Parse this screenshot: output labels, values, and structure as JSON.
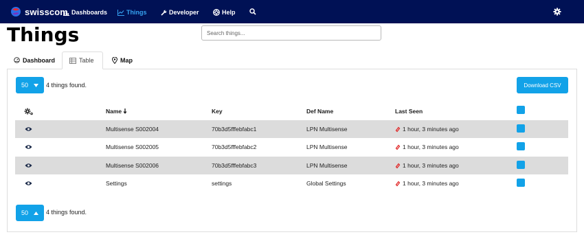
{
  "nav": {
    "brand": "swisscom",
    "items": [
      {
        "label": "Dashboards",
        "icon": "bar-chart-icon"
      },
      {
        "label": "Things",
        "icon": "line-chart-icon",
        "active": true
      },
      {
        "label": "Developer",
        "icon": "wrench-icon"
      },
      {
        "label": "Help",
        "icon": "lifebuoy-icon"
      }
    ],
    "search_icon": "search-icon",
    "settings_icon": "gear-icon"
  },
  "page": {
    "title": "Things",
    "search_placeholder": "Search things..."
  },
  "tabs": [
    {
      "label": "Dashboard",
      "icon": "dashboard-icon"
    },
    {
      "label": "Table",
      "icon": "table-icon",
      "active": true
    },
    {
      "label": "Map",
      "icon": "map-marker-icon"
    }
  ],
  "toolbar": {
    "per_page_top": "50",
    "per_page_bottom": "50",
    "found_top": "4 things found.",
    "found_bottom": "4 things found.",
    "download_label": "Download CSV"
  },
  "table": {
    "columns": [
      "Name",
      "Key",
      "Def Name",
      "Last Seen"
    ],
    "rows": [
      {
        "name": "Multisense S002004",
        "key": "70b3d5fffebfabc1",
        "def_name": "LPN Multisense",
        "last_seen": "1 hour, 3 minutes ago"
      },
      {
        "name": "Multisense S002005",
        "key": "70b3d5fffebfabc2",
        "def_name": "LPN Multisense",
        "last_seen": "1 hour, 3 minutes ago"
      },
      {
        "name": "Multisense S002006",
        "key": "70b3d5fffebfabc3",
        "def_name": "LPN Multisense",
        "last_seen": "1 hour, 3 minutes ago"
      },
      {
        "name": "Settings",
        "key": "settings",
        "def_name": "Global Settings",
        "last_seen": "1 hour, 3 minutes ago"
      }
    ]
  },
  "colors": {
    "navbar": "#001155",
    "accent": "#12a2e8",
    "active_nav": "#36a3f2",
    "row_stripe": "#dcdcdc",
    "link_icon": "#e02020"
  }
}
